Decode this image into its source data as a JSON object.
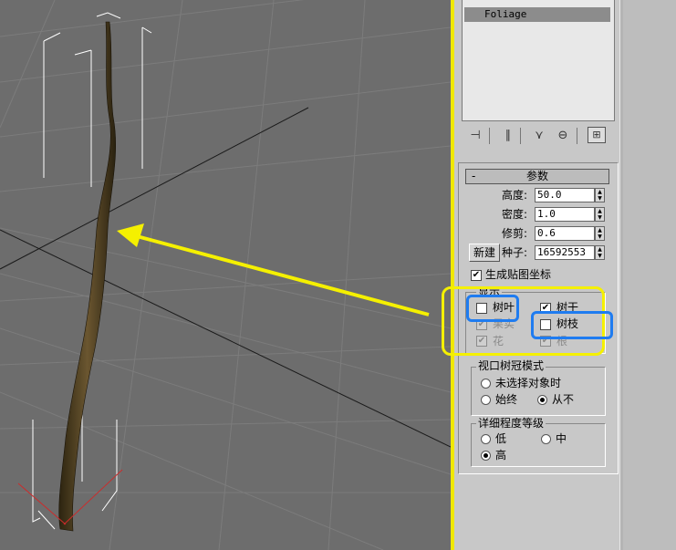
{
  "modifier_stack": {
    "items": [
      "Foliage"
    ]
  },
  "toolbar": {
    "icons": [
      "pin-stack-icon",
      "show-end-result-icon",
      "make-unique-icon",
      "remove-modifier-icon",
      "configure-modifier-sets-icon"
    ]
  },
  "parameters": {
    "title": "参数",
    "collapse": "-",
    "height_label": "高度:",
    "height_value": "50.0",
    "density_label": "密度:",
    "density_value": "1.0",
    "prune_label": "修剪:",
    "prune_value": "0.6",
    "new_button": "新建",
    "seed_label": "种子:",
    "seed_value": "16592553",
    "gen_mapping_label": "生成贴图坐标",
    "gen_mapping_checked": true
  },
  "display": {
    "title": "显示",
    "leaves": {
      "label": "树叶",
      "checked": false
    },
    "trunk": {
      "label": "树干",
      "checked": true
    },
    "fruit": {
      "label": "果实",
      "checked": true,
      "disabled": true
    },
    "branches": {
      "label": "树枝",
      "checked": false
    },
    "flowers": {
      "label": "花",
      "checked": true,
      "disabled": true
    },
    "roots": {
      "label": "根",
      "checked": true,
      "disabled": true
    }
  },
  "canopy_mode": {
    "title": "视口树冠模式",
    "when_not_selected": "未选择对象时",
    "always": "始终",
    "never": "从不",
    "selected": "never"
  },
  "level_of_detail": {
    "title": "详细程度等级",
    "low": "低",
    "medium": "中",
    "high": "高",
    "selected": "high"
  },
  "colors": {
    "highlight_yellow": "#f5f000",
    "highlight_blue": "#1f7cf0",
    "trunk_brown": "#4a3a1c"
  }
}
